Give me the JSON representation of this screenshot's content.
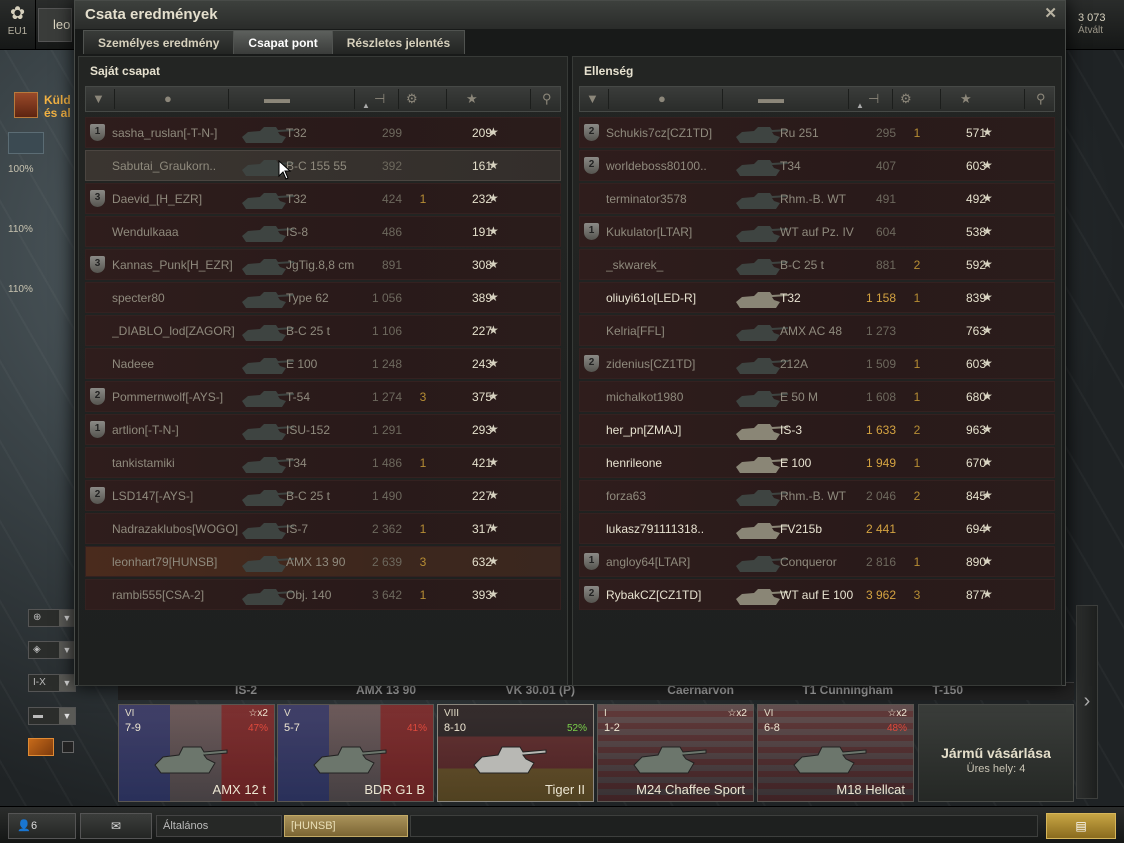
{
  "app": {
    "server": "EU1",
    "username_fragment": "leo",
    "credits": "3 073",
    "credits_action": "Átvált"
  },
  "garage": {
    "quest_text_line1": "Küld",
    "quest_text_line2": "és al",
    "crew_percents": [
      "100%",
      "110%",
      "110%"
    ],
    "filters": [
      "⊕",
      "◈",
      "I-X",
      "▬"
    ]
  },
  "window": {
    "title": "Csata eredmények",
    "tabs": [
      {
        "label": "Személyes eredmény",
        "active": false
      },
      {
        "label": "Csapat pont",
        "active": true
      },
      {
        "label": "Részletes jelentés",
        "active": false
      }
    ],
    "own_team": {
      "title": "Saját csapat",
      "players": [
        {
          "clan_badge": "1",
          "name": "sasha_ruslan[-T-N-]",
          "tank": "T32",
          "damage": "299",
          "kills": "",
          "xp": "209",
          "state": "dead"
        },
        {
          "clan_badge": "",
          "name": "Sabutai_Graukorn..",
          "tank": "B-C 155 55",
          "damage": "392",
          "kills": "",
          "xp": "161",
          "state": "hover"
        },
        {
          "clan_badge": "3",
          "name": "Daevid_[H_EZR]",
          "tank": "T32",
          "damage": "424",
          "kills": "1",
          "xp": "232",
          "state": "dead"
        },
        {
          "clan_badge": "",
          "name": "Wendulkaaa",
          "tank": "IS-8",
          "damage": "486",
          "kills": "",
          "xp": "191",
          "state": "dead"
        },
        {
          "clan_badge": "3",
          "name": "Kannas_Punk[H_EZR]",
          "tank": "JgTig.8,8 cm",
          "damage": "891",
          "kills": "",
          "xp": "308",
          "state": "dead"
        },
        {
          "clan_badge": "",
          "name": "specter80",
          "tank": "Type 62",
          "damage": "1 056",
          "kills": "",
          "xp": "389",
          "state": "dead"
        },
        {
          "clan_badge": "",
          "name": "_DIABLO_lod[ZAGOR]",
          "tank": "B-C 25 t",
          "damage": "1 106",
          "kills": "",
          "xp": "227",
          "state": "dead"
        },
        {
          "clan_badge": "",
          "name": "Nadeee",
          "tank": "E 100",
          "damage": "1 248",
          "kills": "",
          "xp": "243",
          "state": "dead"
        },
        {
          "clan_badge": "2",
          "name": "Pommernwolf[-AYS-]",
          "tank": "T-54",
          "damage": "1 274",
          "kills": "3",
          "xp": "375",
          "state": "dead"
        },
        {
          "clan_badge": "1",
          "name": "artlion[-T-N-]",
          "tank": "ISU-152",
          "damage": "1 291",
          "kills": "",
          "xp": "293",
          "state": "dead"
        },
        {
          "clan_badge": "",
          "name": "tankistamiki",
          "tank": "T34",
          "damage": "1 486",
          "kills": "1",
          "xp": "421",
          "state": "dead"
        },
        {
          "clan_badge": "2",
          "name": "LSD147[-AYS-]",
          "tank": "B-C 25 t",
          "damage": "1 490",
          "kills": "",
          "xp": "227",
          "state": "dead"
        },
        {
          "clan_badge": "",
          "name": "Nadrazaklubos[WOGO]",
          "tank": "IS-7",
          "damage": "2 362",
          "kills": "1",
          "xp": "317",
          "state": "dead"
        },
        {
          "clan_badge": "",
          "name": "leonhart79[HUNSB]",
          "tank": "AMX 13 90",
          "damage": "2 639",
          "kills": "3",
          "xp": "632",
          "state": "self"
        },
        {
          "clan_badge": "",
          "name": "rambi555[CSA-2]",
          "tank": "Obj. 140",
          "damage": "3 642",
          "kills": "1",
          "xp": "393",
          "state": "dead"
        }
      ]
    },
    "enemy_team": {
      "title": "Ellenség",
      "players": [
        {
          "clan_badge": "2",
          "name": "Schukis7cz[CZ1TD]",
          "tank": "Ru 251",
          "damage": "295",
          "kills": "1",
          "xp": "571",
          "state": "dead"
        },
        {
          "clan_badge": "2",
          "name": "worldeboss80100..",
          "tank": "T34",
          "damage": "407",
          "kills": "",
          "xp": "603",
          "state": "dead"
        },
        {
          "clan_badge": "",
          "name": "terminator3578",
          "tank": "Rhm.-B. WT",
          "damage": "491",
          "kills": "",
          "xp": "492",
          "state": "dead"
        },
        {
          "clan_badge": "1",
          "name": "Kukulator[LTAR]",
          "tank": "WT auf Pz. IV",
          "damage": "604",
          "kills": "",
          "xp": "538",
          "state": "dead"
        },
        {
          "clan_badge": "",
          "name": "_skwarek_",
          "tank": "B-C 25 t",
          "damage": "881",
          "kills": "2",
          "xp": "592",
          "state": "dead"
        },
        {
          "clan_badge": "",
          "name": "oliuyi61o[LED-R]",
          "tank": "T32",
          "damage": "1 158",
          "kills": "1",
          "xp": "839",
          "state": "alive"
        },
        {
          "clan_badge": "",
          "name": "Kelria[FFL]",
          "tank": "AMX AC 48",
          "damage": "1 273",
          "kills": "",
          "xp": "763",
          "state": "dead"
        },
        {
          "clan_badge": "2",
          "name": "zidenius[CZ1TD]",
          "tank": "212A",
          "damage": "1 509",
          "kills": "1",
          "xp": "603",
          "state": "dead"
        },
        {
          "clan_badge": "",
          "name": "michalkot1980",
          "tank": "E 50 M",
          "damage": "1 608",
          "kills": "1",
          "xp": "680",
          "state": "dead"
        },
        {
          "clan_badge": "",
          "name": "her_pn[ZMAJ]",
          "tank": "IS-3",
          "damage": "1 633",
          "kills": "2",
          "xp": "963",
          "state": "alive"
        },
        {
          "clan_badge": "",
          "name": "henrileone",
          "tank": "E 100",
          "damage": "1 949",
          "kills": "1",
          "xp": "670",
          "state": "alive"
        },
        {
          "clan_badge": "",
          "name": "forza63",
          "tank": "Rhm.-B. WT",
          "damage": "2 046",
          "kills": "2",
          "xp": "845",
          "state": "dead"
        },
        {
          "clan_badge": "",
          "name": "lukasz791111318..",
          "tank": "FV215b",
          "damage": "2 441",
          "kills": "",
          "xp": "694",
          "state": "alive"
        },
        {
          "clan_badge": "1",
          "name": "angloy64[LTAR]",
          "tank": "Conqueror",
          "damage": "2 816",
          "kills": "1",
          "xp": "890",
          "state": "dead"
        },
        {
          "clan_badge": "2",
          "name": "RybakCZ[CZ1TD]",
          "tank": "WT auf E 100",
          "damage": "3 962",
          "kills": "3",
          "xp": "877",
          "state": "alive"
        }
      ]
    },
    "star_glyph": "★"
  },
  "carousel": {
    "strip_labels": [
      "IS-2",
      "AMX 13 90",
      "VK 30.01 (P)",
      "Caernarvon",
      "T1 Cunningham",
      "T-150"
    ],
    "tanks": [
      {
        "tier": "VI",
        "mm": "7-9",
        "xp": "☆x2",
        "percent": "47%",
        "name": "AMX 12 t",
        "nation": "fr"
      },
      {
        "tier": "V",
        "mm": "5-7",
        "xp": "",
        "percent": "41%",
        "name": "BDR G1 B",
        "nation": "fr"
      },
      {
        "tier": "VIII",
        "mm": "8-10",
        "xp": "",
        "percent": "52%",
        "name": "Tiger II",
        "nation": "de"
      },
      {
        "tier": "I",
        "mm": "1-2",
        "xp": "☆x2",
        "percent": "",
        "name": "M24 Chaffee Sport",
        "nation": "us"
      },
      {
        "tier": "VI",
        "mm": "6-8",
        "xp": "☆x2",
        "percent": "48%",
        "name": "M18 Hellcat",
        "nation": "us"
      }
    ],
    "buy": {
      "title": "Jármű vásárlása",
      "subtitle": "Üres hely: 4"
    }
  },
  "bottom": {
    "online_count": "6",
    "channel_general": "Általános",
    "channel_clan": "[HUNSB]"
  }
}
